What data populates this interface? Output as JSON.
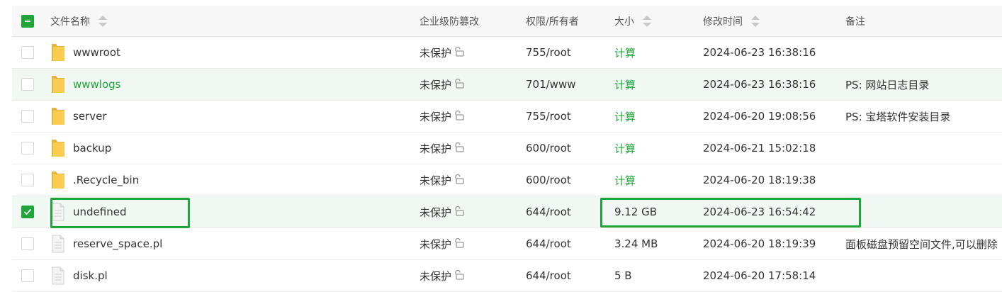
{
  "header": {
    "name": "文件名称",
    "protect": "企业级防篡改",
    "perm": "权限/所有者",
    "size": "大小",
    "mtime": "修改时间",
    "note": "备注"
  },
  "files": [
    {
      "name": "wwwroot",
      "type": "folder",
      "protect": "未保护",
      "perm": "755/root",
      "size": "计算",
      "mtime": "2024-06-23 16:38:16",
      "note": ""
    },
    {
      "name": "wwwlogs",
      "type": "folder",
      "protect": "未保护",
      "perm": "701/www",
      "size": "计算",
      "mtime": "2024-06-23 16:38:16",
      "note": "PS: 网站日志目录"
    },
    {
      "name": "server",
      "type": "folder",
      "protect": "未保护",
      "perm": "755/root",
      "size": "计算",
      "mtime": "2024-06-20 19:08:56",
      "note": "PS: 宝塔软件安装目录"
    },
    {
      "name": "backup",
      "type": "folder",
      "protect": "未保护",
      "perm": "600/root",
      "size": "计算",
      "mtime": "2024-06-21 15:02:18",
      "note": ""
    },
    {
      "name": ".Recycle_bin",
      "type": "folder",
      "protect": "未保护",
      "perm": "600/root",
      "size": "计算",
      "mtime": "2024-06-20 18:19:38",
      "note": ""
    },
    {
      "name": "undefined",
      "type": "file",
      "protect": "未保护",
      "perm": "644/root",
      "size": "9.12 GB",
      "mtime": "2024-06-23 16:54:42",
      "note": ""
    },
    {
      "name": "reserve_space.pl",
      "type": "file",
      "protect": "未保护",
      "perm": "644/root",
      "size": "3.24 MB",
      "mtime": "2024-06-20 18:19:39",
      "note": "面板磁盘预留空间文件,可以删除"
    },
    {
      "name": "disk.pl",
      "type": "file",
      "protect": "未保护",
      "perm": "644/root",
      "size": "5 B",
      "mtime": "2024-06-20 17:58:14",
      "note": ""
    }
  ],
  "colors": {
    "accent": "#20a53a",
    "folder": "#f8cd52",
    "hover_row": "#f1f8f3"
  },
  "icons": {
    "folder": "folder-icon",
    "file": "file-icon",
    "lock": "unlocked-icon"
  }
}
